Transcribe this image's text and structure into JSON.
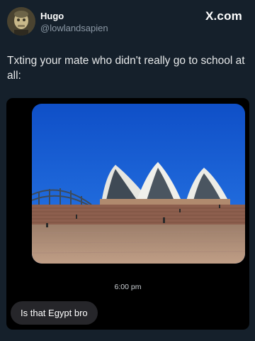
{
  "author": {
    "name": "Hugo",
    "handle": "@lowlandsapien",
    "avatar_icon": "avatar-portrait"
  },
  "brand": {
    "logo_text": "X.com"
  },
  "tweet": {
    "text": "Txting your mate who didn't really go to school at all:"
  },
  "screenshot": {
    "photo": {
      "subject": "sydney-opera-house-photo"
    },
    "timestamp": "6:00 pm",
    "message": "Is that Egypt bro"
  },
  "colors": {
    "background": "#15202b",
    "chat_background": "#000000",
    "bubble": "#26262a",
    "sky": "#1a5fd1"
  }
}
